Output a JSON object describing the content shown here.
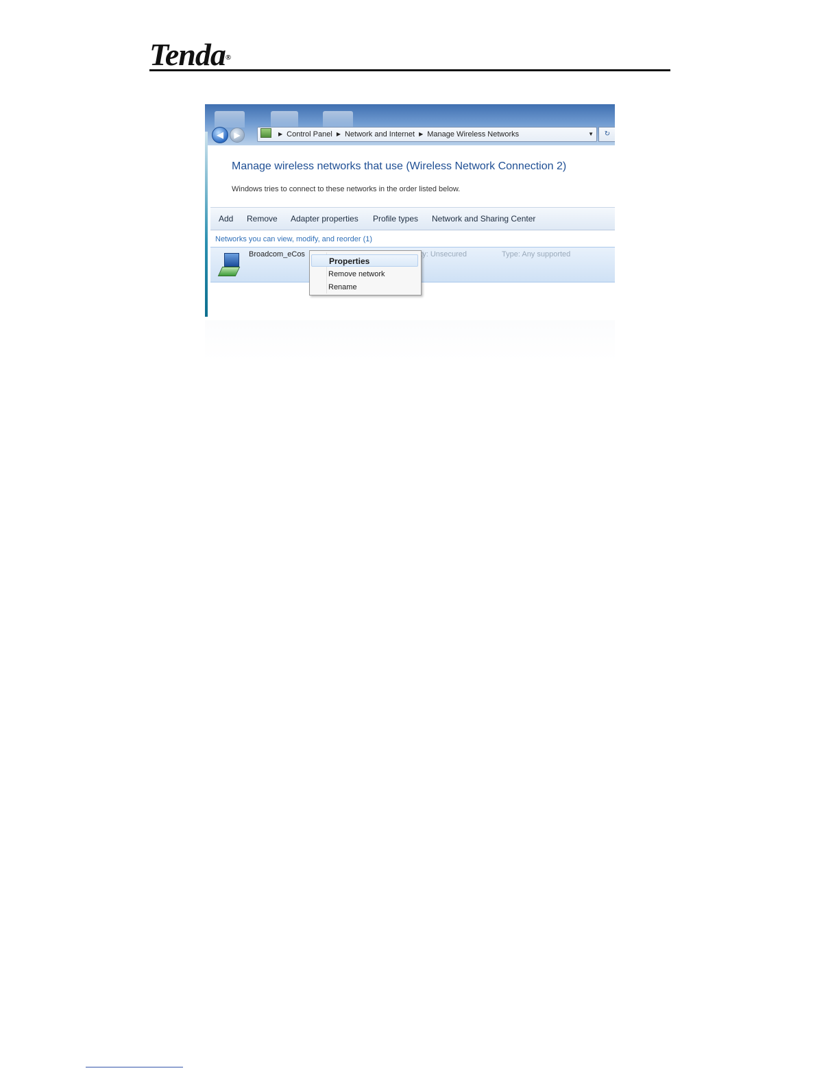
{
  "page": {
    "brand": "Tenda",
    "brand_mark": "®"
  },
  "window": {
    "address": {
      "crumbs": [
        "Control Panel",
        "Network and Internet",
        "Manage Wireless Networks"
      ]
    },
    "title": "Manage wireless networks that use (Wireless Network Connection 2)",
    "description": "Windows tries to connect to these networks in the order listed below.",
    "toolbar": {
      "add": "Add",
      "remove": "Remove",
      "adapter_properties": "Adapter properties",
      "profile_types": "Profile types",
      "network_sharing": "Network and Sharing Center"
    },
    "group_label": "Networks you can view, modify, and reorder (1)",
    "network": {
      "name": "Broadcom_eCos",
      "security": "Security: Unsecured",
      "type": "Type: Any supported"
    },
    "context_menu": {
      "properties": "Properties",
      "remove_network": "Remove network",
      "rename": "Rename"
    }
  },
  "colors": {
    "title_blue": "#1f4f94",
    "group_link_blue": "#2f6fb8",
    "selection_blue": "#cfe1f5"
  }
}
